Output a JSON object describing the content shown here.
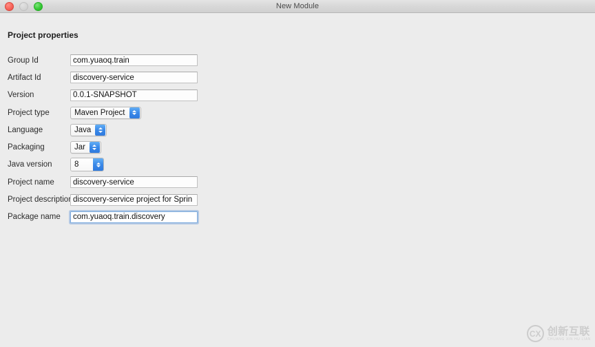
{
  "window": {
    "title": "New Module",
    "traffic_lights": [
      {
        "name": "close",
        "color": "#f8665c"
      },
      {
        "name": "minimize",
        "color": "#d4d4d4"
      },
      {
        "name": "maximize",
        "color": "#37c935"
      }
    ]
  },
  "section": {
    "title": "Project properties"
  },
  "form": {
    "fields": [
      {
        "label": "Group Id",
        "type": "text",
        "value": "com.yuaoq.train",
        "focused": false
      },
      {
        "label": "Artifact Id",
        "type": "text",
        "value": "discovery-service",
        "focused": false
      },
      {
        "label": "Version",
        "type": "text",
        "value": "0.0.1-SNAPSHOT",
        "focused": false
      },
      {
        "label": "Project type",
        "type": "popup",
        "value": "Maven Project",
        "focused": false
      },
      {
        "label": "Language",
        "type": "popup",
        "value": "Java",
        "focused": false
      },
      {
        "label": "Packaging",
        "type": "popup",
        "value": "Jar",
        "focused": false
      },
      {
        "label": "Java version",
        "type": "stepper",
        "value": "8",
        "focused": false
      },
      {
        "label": "Project name",
        "type": "text",
        "value": "discovery-service",
        "focused": false
      },
      {
        "label": "Project description",
        "type": "text",
        "value": "discovery-service project for Sprin",
        "focused": false
      },
      {
        "label": "Package name",
        "type": "text",
        "value": "com.yuaoq.train.discovery",
        "focused": true
      }
    ]
  },
  "watermark": {
    "mark": "CX",
    "name_cn": "创新互联",
    "name_pinyin": "CHUANG XIN HU LIAN"
  },
  "colors": {
    "accent_blue": "#3a89e8",
    "focus_ring": "#7aa9dd",
    "window_bg": "#ececec",
    "titlebar_bg": "#d8d8d8"
  }
}
